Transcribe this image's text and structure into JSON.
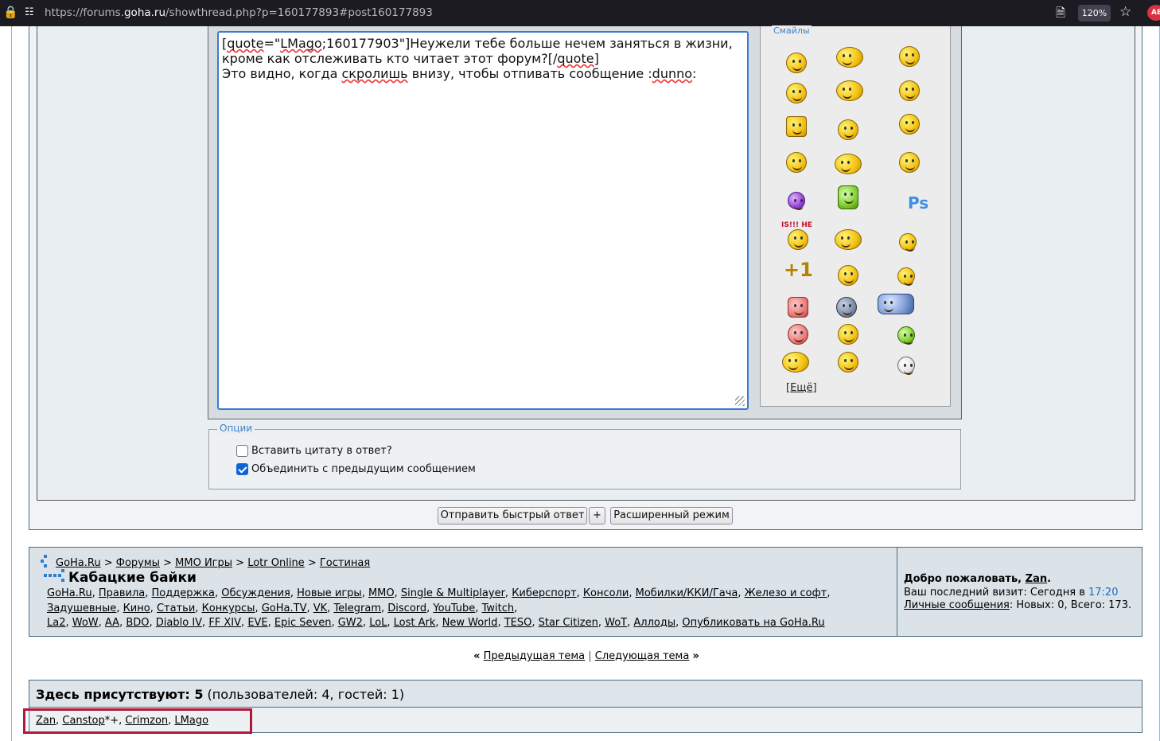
{
  "browser": {
    "url_prefix": "https://forums.",
    "url_domain": "goha.ru",
    "url_suffix": "/showthread.php?p=160177893#post160177893",
    "zoom": "120%",
    "ext_badge": "AB"
  },
  "editor": {
    "line1_a": "[",
    "line1_sq1": "quote",
    "line1_b": "=\"",
    "line1_sq2": "LMago",
    "line1_c": ";160177903\"]Неужели тебе больше нечем заняться в жизни,",
    "line2_a": "кроме как отслеживать кто читает этот форум?[/",
    "line2_sq": "quote",
    "line2_b": "]",
    "line3_a": "Это видно, когда ",
    "line3_sq1": "скролишь",
    "line3_b": " внизу, чтобы отпивать сообщение :",
    "line3_sq2": "dunno",
    "line3_c": ":"
  },
  "smilies": {
    "legend": "Смайлы",
    "more": "[Ещё]",
    "ps_icon": "Ps",
    "icon_text_top": "IS!!! НЕ"
  },
  "options": {
    "legend": "Опции",
    "quote_label": "Вставить цитату в ответ?",
    "quote_checked": false,
    "merge_label": "Объединить с предыдущим сообщением",
    "merge_checked": true
  },
  "buttons": {
    "send": "Отправить быстрый ответ",
    "plus": "+",
    "advanced": "Расширенный режим"
  },
  "breadcrumb": {
    "items": [
      "GoHa.Ru",
      "Форумы",
      "MMO Игры",
      "Lotr Online",
      "Гостиная"
    ],
    "sep": ">",
    "title": "Кабацкие байки"
  },
  "nav_links": {
    "line1": [
      "GoHa.Ru",
      "Правила",
      "Поддержка",
      "Обсуждения",
      "Новые игры",
      "MMO",
      "Single & Multiplayer",
      "Киберспорт",
      "Консоли",
      "Мобилки/ККИ/Гача",
      "Железо и софт"
    ],
    "line2": [
      "Задушевные",
      "Кино",
      "Статьи",
      "Конкурсы",
      "GoHa.TV",
      "VK",
      "Telegram",
      "Discord",
      "YouTube",
      "Twitch"
    ],
    "line3": [
      "La2",
      "WoW",
      "AA",
      "BDO",
      "Diablo IV",
      "FF XIV",
      "EVE",
      "Epic Seven",
      "GW2",
      "LoL",
      "Lost Ark",
      "New World",
      "TESO",
      "Star Citizen",
      "WoT",
      "Аллоды",
      "Опубликовать на GoHa.Ru"
    ]
  },
  "welcome": {
    "prefix": "Добро пожаловать, ",
    "user": "Zan",
    "suffix": ".",
    "last_visit_label": "Ваш последний визит: Сегодня в ",
    "last_visit_time": "17:20",
    "pm_link": "Личные сообщения",
    "pm_stats": ": Новых: 0, Всего: 173."
  },
  "thread_nav": {
    "prev_arrow": "«",
    "prev": "Предыдущая тема",
    "sep": "|",
    "next": "Следующая тема",
    "next_arrow": "»"
  },
  "online": {
    "head_bold": "Здесь присутствуют: 5",
    "head_rest": " (пользователей: 4, гостей: 1)",
    "users": [
      {
        "name": "Zan",
        "mark": ""
      },
      {
        "name": "Canstop",
        "mark": "*+"
      },
      {
        "name": "Crimzon",
        "mark": ""
      },
      {
        "name": "LMago",
        "mark": ""
      }
    ]
  }
}
